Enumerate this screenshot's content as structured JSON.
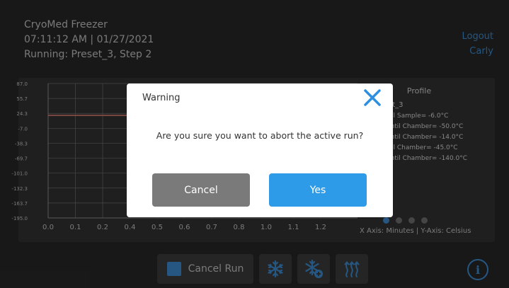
{
  "header": {
    "device_name": "CryoMed Freezer",
    "datetime": "07:11:12 AM | 01/27/2021",
    "status": "Running: Preset_3, Step 2",
    "logout_label": "Logout",
    "user": "Carly"
  },
  "chart_data": {
    "type": "line",
    "y_ticks": [
      "87.0",
      "55.7",
      "24.3",
      "-7.0",
      "-38.3",
      "-69.7",
      "-101.0",
      "-132.3",
      "-163.7",
      "-195.0"
    ],
    "x_ticks": [
      "0.0",
      "0.1",
      "0.2",
      "0.4",
      "0.5",
      "0.6",
      "0.7",
      "0.8",
      "1.0",
      "1.1",
      "1.2"
    ],
    "ylim": [
      -195.0,
      87.0
    ],
    "xlim": [
      0.0,
      1.2
    ],
    "grid": true,
    "series": [
      {
        "x": [
          0.0,
          1.2
        ],
        "values": [
          20.0,
          20.0
        ],
        "color": "#d9776c"
      }
    ],
    "axis_note": "X Axis: Minutes | Y-Axis: Celsius"
  },
  "profile": {
    "title": "Profile",
    "name": "Preset_3",
    "steps": [
      "in until Sample= -6.0°C",
      "Min until Chamber= -50.0°C",
      "Min until Chamber= -14.0°C",
      "in until Chamber= -45.0°C",
      "Min until Chamber= -140.0°C"
    ]
  },
  "page_dots": {
    "count": 4,
    "active": 0
  },
  "toolbar": {
    "cancel_run_label": "Cancel Run"
  },
  "modal": {
    "title": "Warning",
    "message": "Are you sure you want to abort the active run?",
    "cancel_label": "Cancel",
    "yes_label": "Yes"
  },
  "colors": {
    "accent": "#3a86c8",
    "yes_button": "#2e9be8",
    "cancel_button": "#7a7a7a",
    "series": "#d9776c"
  }
}
